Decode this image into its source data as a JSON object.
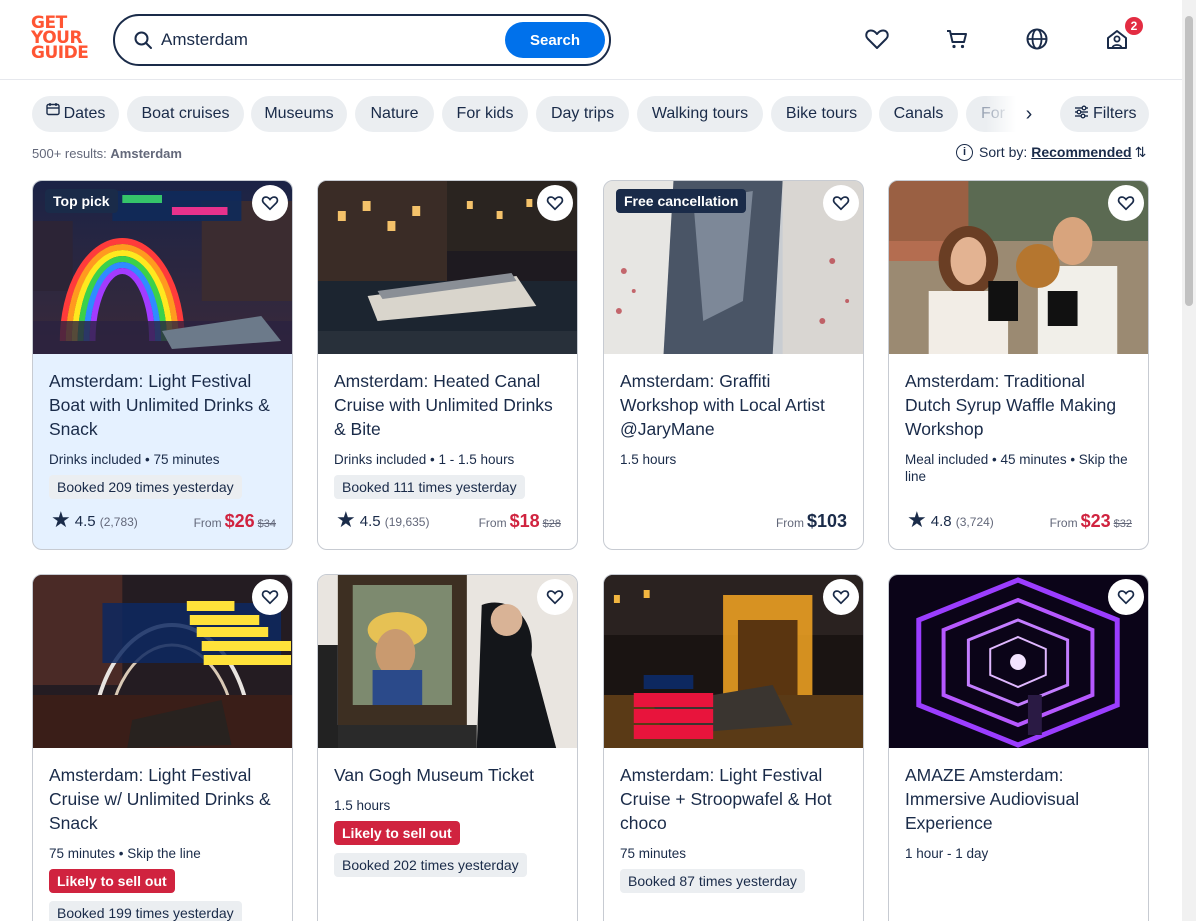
{
  "header": {
    "logo_lines": [
      "GET",
      "YOUR",
      "GUIDE"
    ],
    "search_value": "Amsterdam",
    "search_button": "Search",
    "cart_badge": "2"
  },
  "chips": [
    {
      "label": "Dates"
    },
    {
      "label": "Boat cruises"
    },
    {
      "label": "Museums"
    },
    {
      "label": "Nature"
    },
    {
      "label": "For kids"
    },
    {
      "label": "Day trips"
    },
    {
      "label": "Walking tours"
    },
    {
      "label": "Bike tours"
    },
    {
      "label": "Canals"
    }
  ],
  "chip_partial": "For",
  "filters_label": "Filters",
  "results": {
    "count": "500+ results:",
    "query": "Amsterdam"
  },
  "sort": {
    "label": "Sort by:",
    "value": "Recommended"
  },
  "cards": [
    {
      "tag": "Top pick",
      "title": "Amsterdam: Light Festival Boat with Unlimited Drinks & Snack",
      "meta": "Drinks included • 75 minutes",
      "booked": "Booked 209 times yesterday",
      "rating": "4.5",
      "reviews": "(2,783)",
      "from": "From",
      "price": "$26",
      "old_price": "$34"
    },
    {
      "title": "Amsterdam: Heated Canal Cruise with Unlimited Drinks & Bite",
      "meta": "Drinks included • 1 - 1.5 hours",
      "booked": "Booked 111 times yesterday",
      "rating": "4.5",
      "reviews": "(19,635)",
      "from": "From",
      "price": "$18",
      "old_price": "$28"
    },
    {
      "tag": "Free cancellation",
      "title": "Amsterdam: Graffiti Workshop with Local Artist @JaryMane",
      "meta": "1.5 hours",
      "from": "From",
      "price": "$103"
    },
    {
      "title": "Amsterdam: Traditional Dutch Syrup Waffle Making Workshop",
      "meta": "Meal included • 45 minutes • Skip the line",
      "rating": "4.8",
      "reviews": "(3,724)",
      "from": "From",
      "price": "$23",
      "old_price": "$32"
    },
    {
      "title": "Amsterdam: Light Festival Cruise w/ Unlimited Drinks & Snack",
      "meta": "75 minutes • Skip the line",
      "likely": "Likely to sell out",
      "booked": "Booked 199 times yesterday"
    },
    {
      "title": "Van Gogh Museum Ticket",
      "meta": "1.5 hours",
      "likely": "Likely to sell out",
      "booked": "Booked 202 times yesterday"
    },
    {
      "title": "Amsterdam: Light Festival Cruise + Stroopwafel & Hot choco",
      "meta": "75 minutes",
      "booked": "Booked 87 times yesterday"
    },
    {
      "title": "AMAZE Amsterdam: Immersive Audiovisual Experience",
      "meta": "1 hour - 1 day"
    }
  ],
  "colors": {
    "brand": "#ff5533",
    "accent": "#0071eb",
    "sale": "#d0233f",
    "ink": "#1a2b49"
  }
}
